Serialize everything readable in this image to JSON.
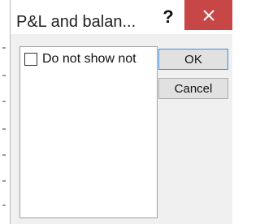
{
  "dialog": {
    "title": "P&L and balan...",
    "help_label": "?",
    "close_icon": "close-x-icon",
    "close_color": "#c74747"
  },
  "list": {
    "items": [
      {
        "label": "Do not show not",
        "checked": false
      }
    ]
  },
  "buttons": {
    "ok_label": "OK",
    "cancel_label": "Cancel",
    "ok_border_color": "#3c8fd6"
  }
}
